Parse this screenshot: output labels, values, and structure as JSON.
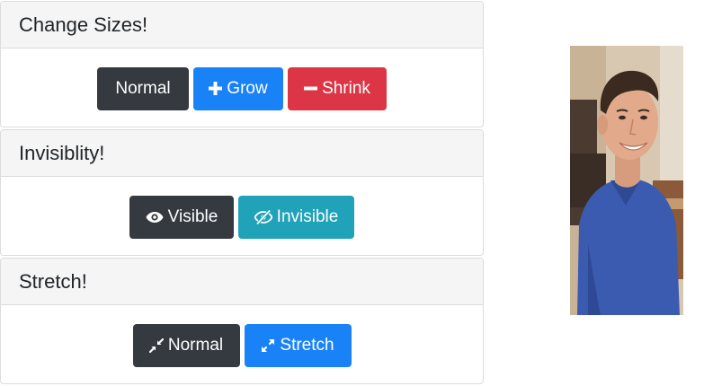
{
  "panels": {
    "sizes": {
      "title": "Change Sizes!",
      "buttons": {
        "normal": "Normal",
        "grow": "Grow",
        "shrink": "Shrink"
      }
    },
    "visibility": {
      "title": "Invisiblity!",
      "buttons": {
        "visible": "Visible",
        "invisible": "Invisible"
      }
    },
    "stretch": {
      "title": "Stretch!",
      "buttons": {
        "normal": "Normal",
        "stretch": "Stretch"
      }
    }
  },
  "icons": {
    "grow": "plus-icon",
    "shrink": "minus-icon",
    "visible": "eye-icon",
    "invisible": "eye-slash-icon",
    "normal_stretch": "compress-icon",
    "stretch": "expand-icon"
  },
  "colors": {
    "dark": "#343a40",
    "primary": "#1a82f7",
    "danger": "#dc3545",
    "info": "#20a2b8"
  }
}
